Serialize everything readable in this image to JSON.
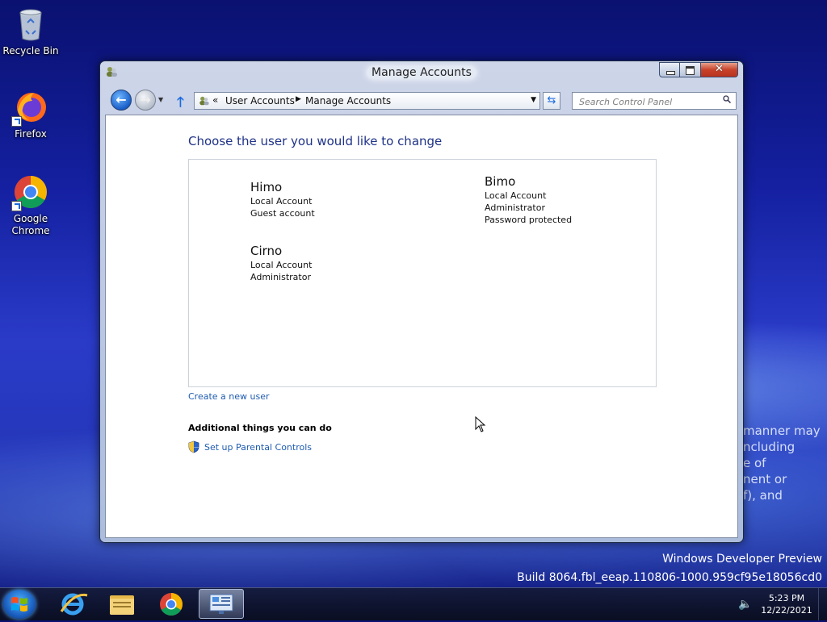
{
  "desktop": {
    "icons": [
      {
        "label": "Recycle Bin"
      },
      {
        "label": "Firefox"
      },
      {
        "label": "Google Chrome"
      }
    ],
    "watermark_side_lines": [
      "manner may",
      "ncluding",
      "e of",
      "nent or",
      "f), and"
    ],
    "watermark_title": "Windows Developer Preview",
    "watermark_build": "Build 8064.fbl_eeap.110806-1000.959cf95e18056cd0"
  },
  "window": {
    "title": "Manage Accounts",
    "close_glyph": "✕",
    "address": {
      "chevron": "«",
      "crumbs": [
        "User Accounts",
        "Manage Accounts"
      ],
      "separator": "▶"
    },
    "search": {
      "placeholder": "Search Control Panel"
    },
    "heading": "Choose the user you would like to change",
    "accounts": [
      {
        "name": "Himo",
        "lines": [
          "Local Account",
          "Guest account"
        ]
      },
      {
        "name": "Bimo",
        "lines": [
          "Local Account",
          "Administrator",
          "Password protected"
        ]
      },
      {
        "name": "Cirno",
        "lines": [
          "Local Account",
          "Administrator"
        ]
      }
    ],
    "create_link": "Create a new user",
    "additional_heading": "Additional things you can do",
    "parental_link": "Set up Parental Controls"
  },
  "taskbar": {
    "time": "5:23 PM",
    "date": "12/22/2021"
  },
  "icons": {
    "recycle": "recycle-bin-icon",
    "firefox": "firefox-icon",
    "chrome": "chrome-icon",
    "shield": "uac-shield-icon"
  }
}
